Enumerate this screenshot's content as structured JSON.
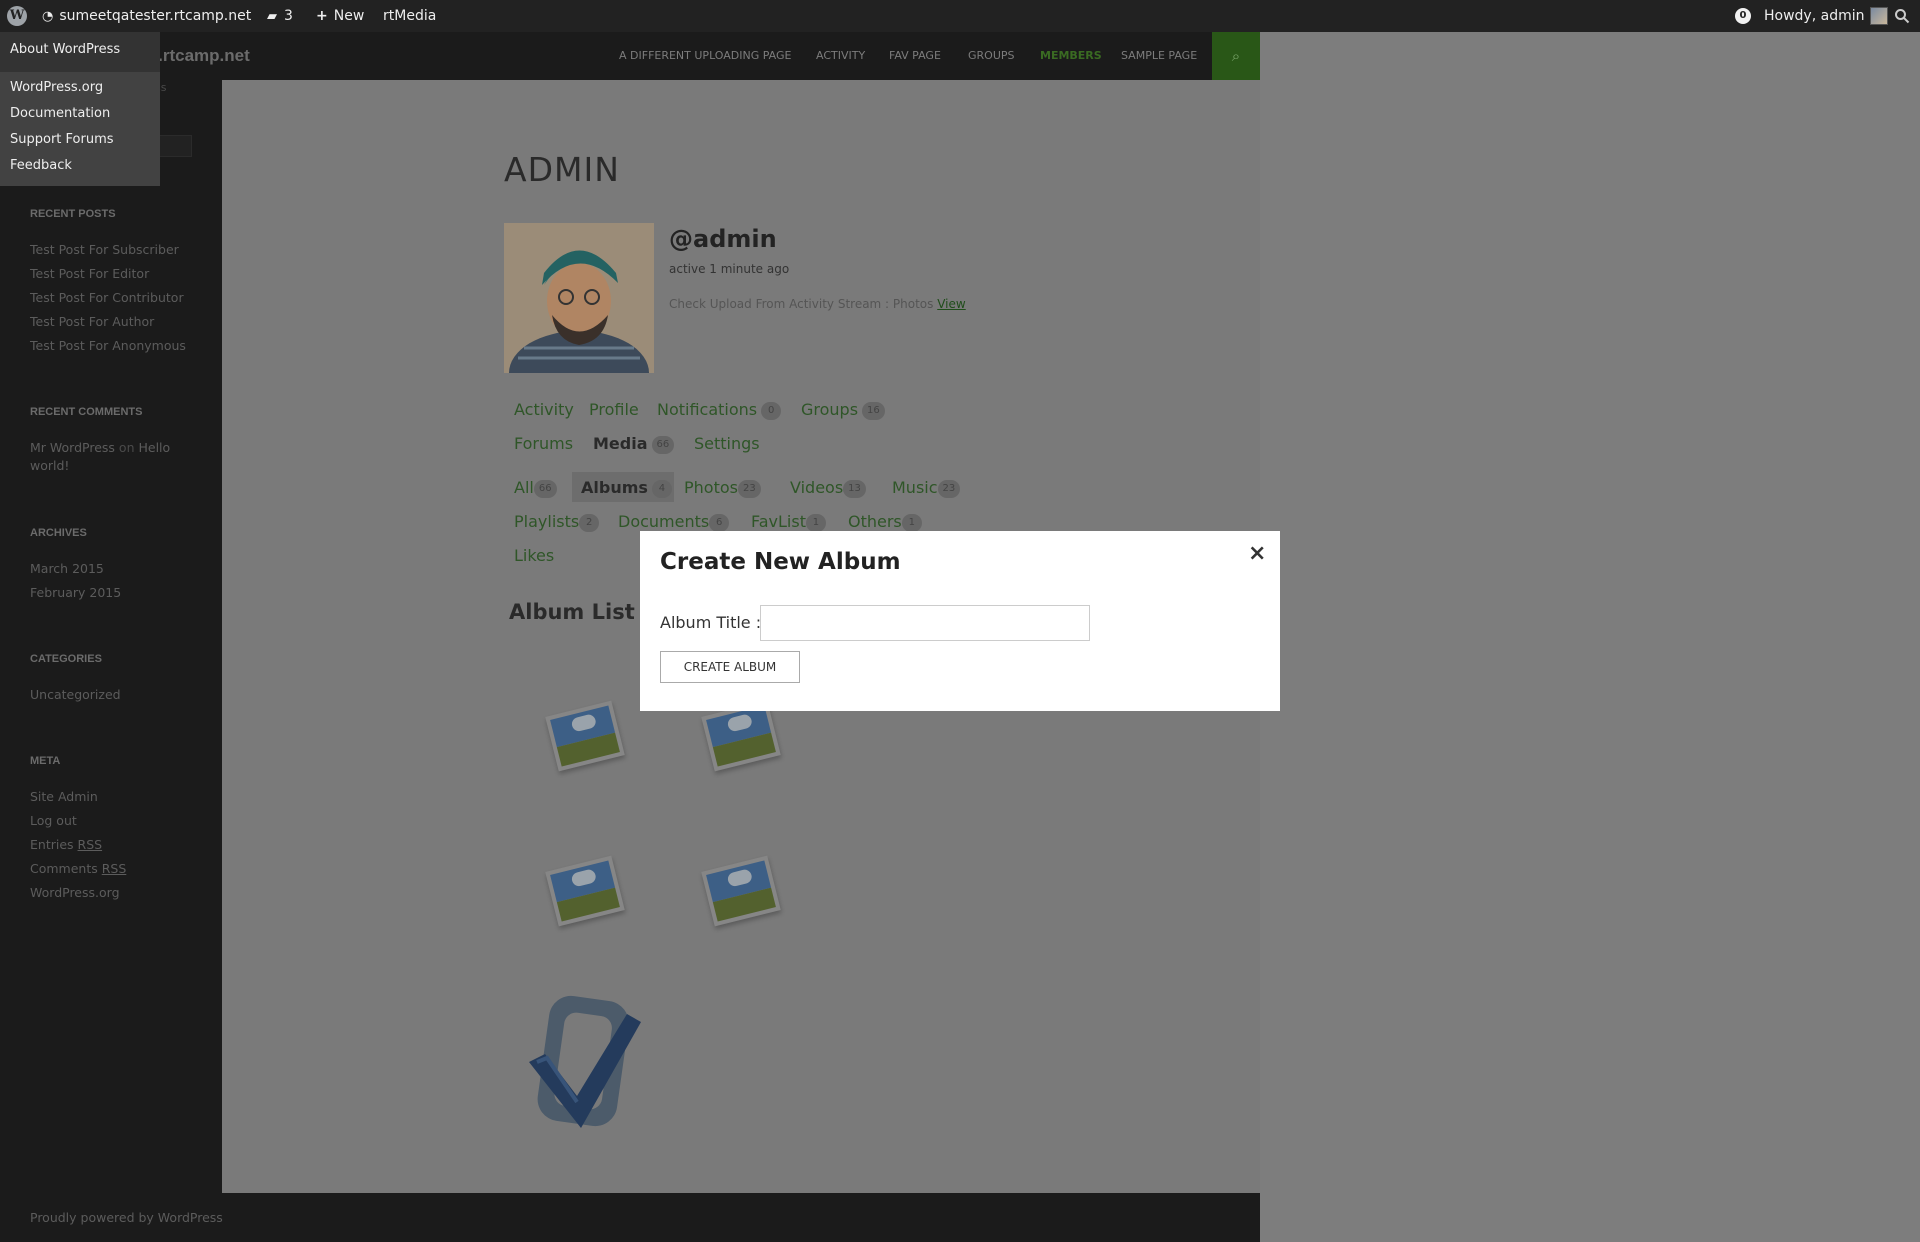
{
  "adminbar": {
    "site_name": "sumeetqatester.rtcamp.net",
    "comments_count": "3",
    "new_label": "New",
    "rtmedia_label": "rtMedia",
    "notif_count": "0",
    "howdy": "Howdy, admin"
  },
  "wp_menu": {
    "about": "About WordPress",
    "items": [
      "WordPress.org",
      "Documentation",
      "Support Forums",
      "Feedback"
    ]
  },
  "site": {
    "title_partial": "er.rtcamp.net",
    "desc_partial": "ss"
  },
  "nav": [
    "A DIFFERENT UPLOADING PAGE",
    "ACTIVITY",
    "FAV PAGE",
    "GROUPS",
    "MEMBERS",
    "SAMPLE PAGE"
  ],
  "widgets": {
    "recent_posts": {
      "title": "RECENT POSTS",
      "items": [
        "Test Post For Subscriber",
        "Test Post For Editor",
        "Test Post For Contributor",
        "Test Post For Author",
        "Test Post For Anonymous"
      ]
    },
    "recent_comments": {
      "title": "RECENT COMMENTS",
      "author": "Mr WordPress",
      "on": "on",
      "post_line1": "Hello",
      "post_line2": "world!"
    },
    "archives": {
      "title": "ARCHIVES",
      "items": [
        "March 2015",
        "February 2015"
      ]
    },
    "categories": {
      "title": "CATEGORIES",
      "items": [
        "Uncategorized"
      ]
    },
    "meta": {
      "title": "META",
      "site_admin": "Site Admin",
      "log_out": "Log out",
      "entries": "Entries",
      "comments": "Comments",
      "rss": "RSS",
      "wordpress_org": "WordPress.org"
    }
  },
  "footer": "Proudly powered by WordPress",
  "profile": {
    "heading": "ADMIN",
    "mention": "@admin",
    "active": "active 1 minute ago",
    "activity_text": "Check Upload From Activity Stream : Photos",
    "activity_link": "View",
    "tabs": {
      "activity": "Activity",
      "profile": "Profile",
      "notifications": "Notifications",
      "notifications_count": "0",
      "groups": "Groups",
      "groups_count": "16",
      "forums": "Forums",
      "media": "Media",
      "media_count": "66",
      "settings": "Settings"
    },
    "media_tabs": {
      "all": "All",
      "all_count": "66",
      "albums": "Albums",
      "albums_count": "4",
      "photos": "Photos",
      "photos_count": "23",
      "videos": "Videos",
      "videos_count": "13",
      "music": "Music",
      "music_count": "23",
      "playlists": "Playlists",
      "playlists_count": "2",
      "documents": "Documents",
      "documents_count": "6",
      "favlist": "FavList",
      "favlist_count": "1",
      "others": "Others",
      "others_count": "1",
      "likes": "Likes"
    },
    "album_list": "Album List"
  },
  "modal": {
    "title": "Create New Album",
    "close": "×",
    "label": "Album Title :",
    "input_value": "",
    "button": "CREATE ALBUM"
  }
}
